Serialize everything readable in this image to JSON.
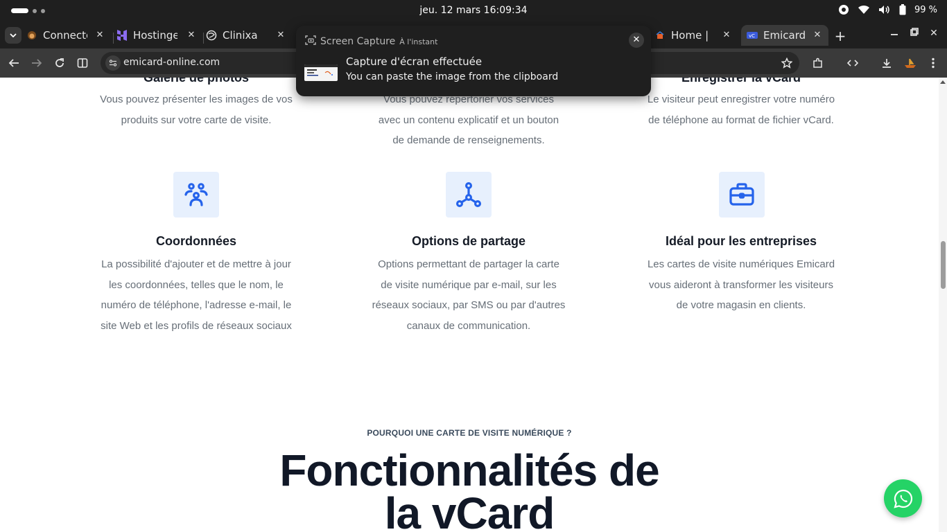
{
  "os": {
    "datetime": "jeu. 12 mars  16:09:34",
    "battery": "99 %"
  },
  "tabs": [
    {
      "title": "Connecte",
      "icon": "monkey-favicon-icon"
    },
    {
      "title": "Hostinger",
      "icon": "hostinger-favicon-icon"
    },
    {
      "title": "Clinixa",
      "icon": "globe-favicon-icon"
    },
    {
      "title": "Home | F",
      "icon": "home-favicon-icon"
    },
    {
      "title": "Emicard",
      "icon": "emicard-favicon-icon",
      "active": true
    }
  ],
  "toolbar": {
    "url": "emicard-online.com"
  },
  "notification": {
    "app": "Screen Capture",
    "time": "À l'instant",
    "title": "Capture d'écran effectuée",
    "body": "You can paste the image from the clipboard",
    "close": "✕"
  },
  "features_top": [
    {
      "title": "Galerie de photos",
      "lines": [
        "Vous pouvez présenter les images de vos",
        "produits sur votre carte de visite."
      ]
    },
    {
      "title": "",
      "lines": [
        "Vous pouvez répertorier vos services",
        "avec un contenu explicatif et un bouton",
        "de demande de renseignements."
      ]
    },
    {
      "title": "Enregistrer la vCard",
      "lines": [
        "Le visiteur peut enregistrer votre numéro",
        "de téléphone au format de fichier vCard."
      ]
    }
  ],
  "features": [
    {
      "title": "Coordonnées",
      "icon": "contacts-group-icon",
      "lines": [
        "La possibilité d'ajouter et de mettre à jour",
        "les coordonnées, telles que le nom, le",
        "numéro de téléphone, l'adresse e-mail, le",
        "site Web et les profils de réseaux sociaux"
      ]
    },
    {
      "title": "Options de partage",
      "icon": "share-nodes-icon",
      "lines": [
        "Options permettant de partager la carte",
        "de visite numérique par e-mail, sur les",
        "réseaux sociaux, par SMS ou par d'autres",
        "canaux de communication."
      ]
    },
    {
      "title": "Idéal pour les entreprises",
      "icon": "briefcase-icon",
      "lines": [
        "Les cartes de visite numériques Emicard",
        "vous aideront à transformer les visiteurs",
        "de votre magasin en clients."
      ]
    }
  ],
  "section": {
    "eyebrow": "POURQUOI UNE CARTE DE VISITE NUMÉRIQUE ?",
    "heading_line1": "Fonctionnalités de",
    "heading_line2": "la vCard"
  },
  "colors": {
    "accent": "#2563eb",
    "icon_bg": "#e7f0fd",
    "whatsapp": "#25d366"
  }
}
